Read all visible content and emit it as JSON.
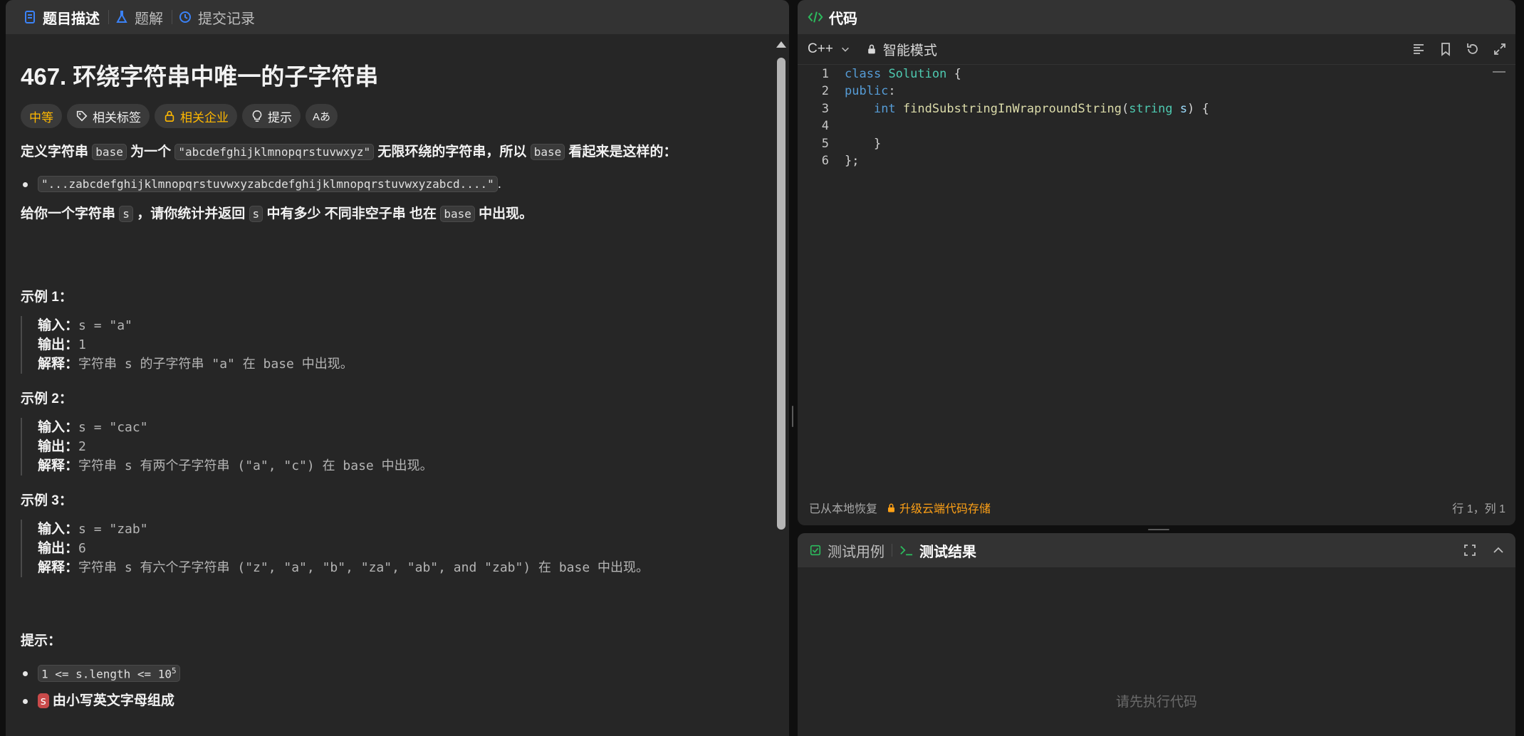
{
  "left_tabs": [
    {
      "label": "题目描述",
      "icon": "document-icon"
    },
    {
      "label": "题解",
      "icon": "flask-icon"
    },
    {
      "label": "提交记录",
      "icon": "history-icon"
    }
  ],
  "problem": {
    "title": "467. 环绕字符串中唯一的子字符串",
    "tags": {
      "difficulty": "中等",
      "related_tags": "相关标签",
      "related_companies": "相关企业",
      "hint": "提示",
      "translate": "Aあ"
    },
    "para1": {
      "t1": "定义字符串",
      "c1": "base",
      "t2": "为一个",
      "c2": "\"abcdefghijklmnopqrstuvwxyz\"",
      "t3": "无限环绕的字符串，所以",
      "c3": "base",
      "t4": "看起来是这样的："
    },
    "bullet1": "\"...zabcdefghijklmnopqrstuvwxyzabcdefghijklmnopqrstuvwxyzabcd....\"",
    "bullet1_tail": ".",
    "para2": {
      "t1": "给你一个字符串",
      "c1": "s",
      "t2": "，请你统计并返回",
      "c2": "s",
      "t3": "中有多少",
      "strong": "不同非空子串",
      "t4": "也在",
      "c3": "base",
      "t5": "中出现。"
    },
    "examples": [
      {
        "title": "示例 1：",
        "input_label": "输入：",
        "input": "s = \"a\"",
        "output_label": "输出：",
        "output": "1",
        "explain_label": "解释：",
        "explain": "字符串 s 的子字符串 \"a\" 在 base 中出现。"
      },
      {
        "title": "示例 2：",
        "input_label": "输入：",
        "input": "s = \"cac\"",
        "output_label": "输出：",
        "output": "2",
        "explain_label": "解释：",
        "explain": "字符串 s 有两个子字符串 (\"a\", \"c\") 在 base 中出现。"
      },
      {
        "title": "示例 3：",
        "input_label": "输入：",
        "input": "s = \"zab\"",
        "output_label": "输出：",
        "output": "6",
        "explain_label": "解释：",
        "explain": "字符串 s 有六个子字符串 (\"z\", \"a\", \"b\", \"za\", \"ab\", and \"zab\") 在 base 中出现。"
      }
    ],
    "hints_title": "提示：",
    "constraint1": "1 <= s.length <= 10",
    "constraint1_sup": "5",
    "constraint2_code": "s",
    "constraint2_text": "由小写英文字母组成"
  },
  "code_panel": {
    "title": "代码",
    "language": "C++",
    "mode": "智能模式",
    "toolbar_icons": [
      "format-icon",
      "bookmark-icon",
      "reset-icon",
      "expand-icon"
    ],
    "lines": [
      "1",
      "2",
      "3",
      "4",
      "5",
      "6"
    ],
    "status_left": "已从本地恢复",
    "upgrade": "升级云端代码存储",
    "cursor": "行 1，列 1"
  },
  "test_panel": {
    "tab_cases": "测试用例",
    "tab_results": "测试结果",
    "empty": "请先执行代码"
  },
  "colors": {
    "accent": "#ffa116",
    "difficulty_medium": "#ffb800",
    "panel_bg": "#262626",
    "header_bg": "#333333"
  }
}
